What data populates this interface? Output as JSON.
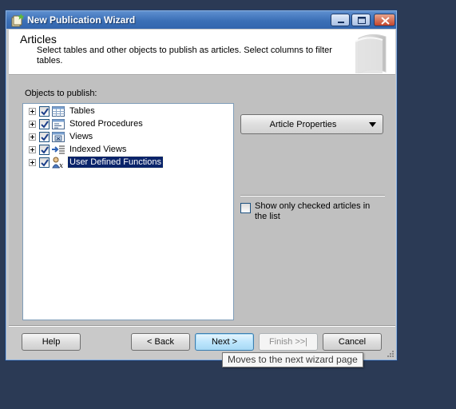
{
  "window": {
    "title": "New Publication Wizard",
    "controls": [
      "minimize-icon",
      "maximize-icon",
      "close-icon"
    ]
  },
  "header": {
    "title": "Articles",
    "subtitle": "Select tables and other objects to publish as articles. Select columns to filter tables."
  },
  "objects": {
    "label": "Objects to publish:",
    "items": [
      {
        "label": "Tables",
        "checked": true,
        "icon": "table-icon",
        "selected": false
      },
      {
        "label": "Stored Procedures",
        "checked": true,
        "icon": "stored-procedure-icon",
        "selected": false
      },
      {
        "label": "Views",
        "checked": true,
        "icon": "view-icon",
        "selected": false
      },
      {
        "label": "Indexed Views",
        "checked": true,
        "icon": "indexed-view-icon",
        "selected": false
      },
      {
        "label": "User Defined Functions",
        "checked": true,
        "icon": "function-icon",
        "selected": true
      }
    ]
  },
  "article_properties": {
    "label": "Article Properties"
  },
  "show_checked": {
    "label": "Show only checked articles in the list",
    "checked": false
  },
  "buttons": {
    "help": "Help",
    "back": "< Back",
    "next": "Next >",
    "finish": "Finish >>|",
    "cancel": "Cancel"
  },
  "tooltip": {
    "text": "Moves to the next wizard page"
  },
  "colors": {
    "desktop": "#2b3a55",
    "titlebar": "#3b6fb6",
    "selection": "#0a246a"
  }
}
